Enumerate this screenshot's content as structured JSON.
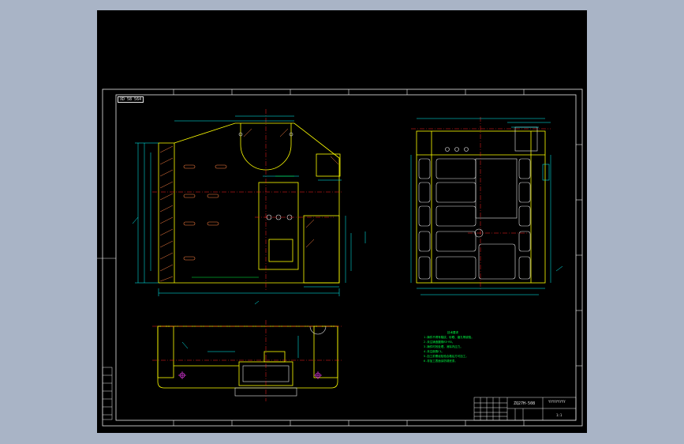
{
  "app": {
    "title": "",
    "background_color": "#a9b4c6",
    "canvas_color": "#000000"
  },
  "drawing": {
    "view_label": "XD 58 564",
    "drawing_number": "ZQ27H-508",
    "scale_note": "1:1",
    "sheet_ref": "YYYYYYYYY",
    "tech_title": "技术要求",
    "notes": [
      "1.铸件不得有裂纹、砂眼、缩孔等缺陷。",
      "2.未注铸造圆角R3~R5。",
      "3.铸件时效处理，消除内应力。",
      "4.未注倒角C1。",
      "5.加工前需经检验合格后方可加工。",
      "6.非加工表面涂防锈底漆。"
    ],
    "colors": {
      "frame": "#e8e8e8",
      "outline": "#ffff00",
      "dimension": "#00ffff",
      "centerline": "#ff2020",
      "hatch": "#ff8040",
      "text": "#00ff44"
    }
  }
}
